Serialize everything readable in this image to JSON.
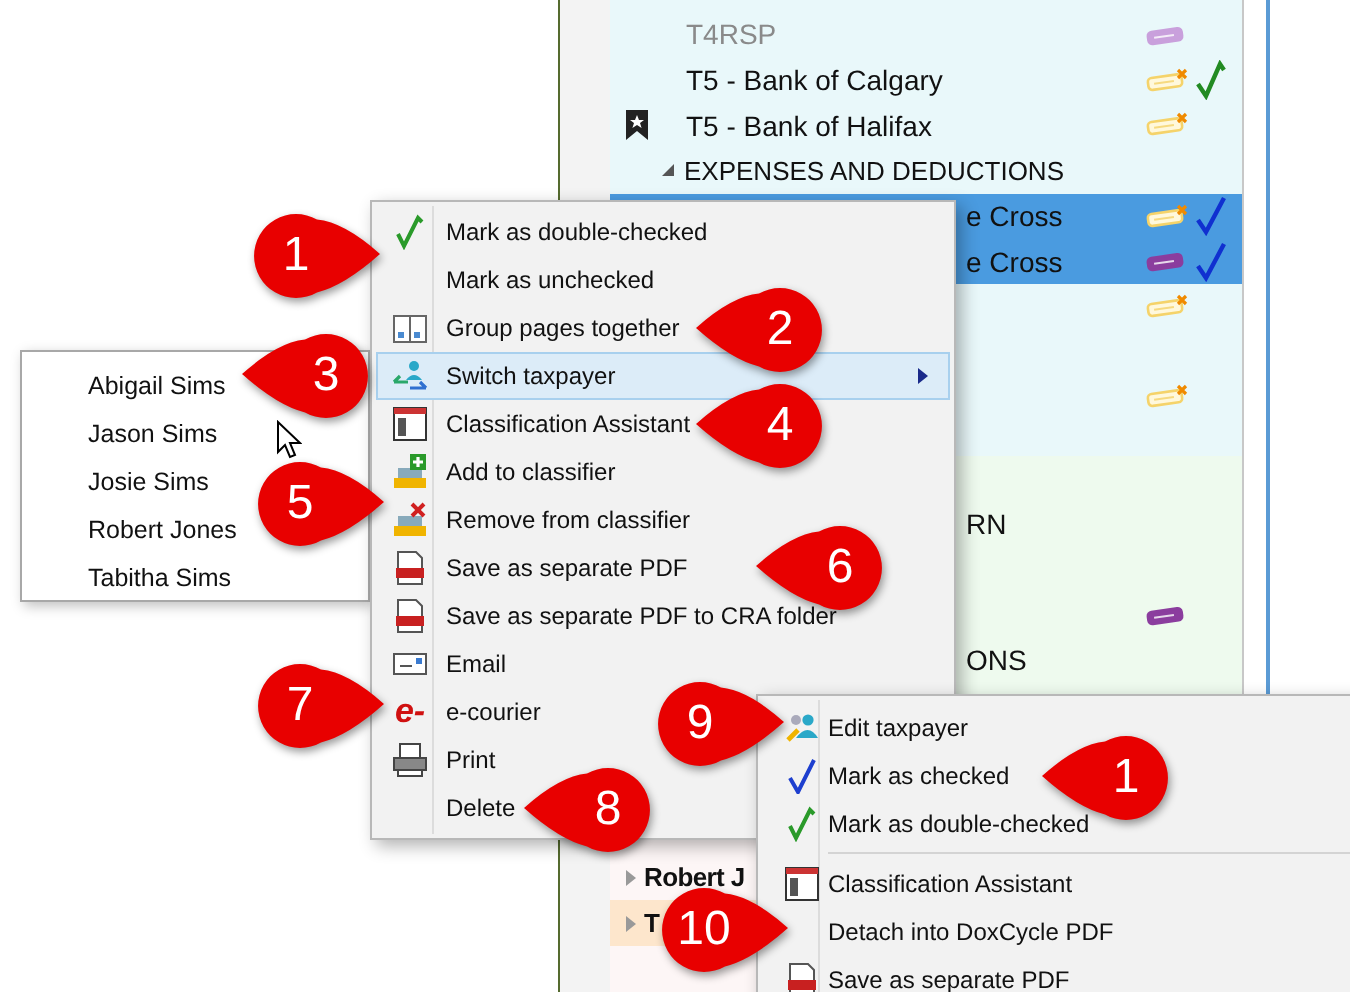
{
  "tree": {
    "groups": [
      {
        "color": "#e9f8fa",
        "rows": [
          {
            "kind": "doc",
            "label": "T4RSP",
            "dim": true,
            "bookmarked": false,
            "selected": false,
            "tag": {
              "color": "#c9a0dc",
              "flagged": false
            },
            "checked": false
          },
          {
            "kind": "doc",
            "label": "T5 - Bank of Calgary",
            "dim": false,
            "bookmarked": false,
            "selected": false,
            "tag": {
              "color": "#f5d36a",
              "flagged": true
            },
            "checked": true,
            "double": true
          },
          {
            "kind": "doc",
            "label": "T5 - Bank of Halifax",
            "dim": false,
            "bookmarked": true,
            "selected": false,
            "tag": {
              "color": "#f5d36a",
              "flagged": true
            },
            "checked": false
          },
          {
            "kind": "heading",
            "label": "EXPENSES AND DEDUCTIONS",
            "dim": false,
            "selected": false,
            "expanded": true,
            "checked": false
          },
          {
            "kind": "cut",
            "label": "e Cross",
            "dim": false,
            "selected": true,
            "tag": {
              "color": "#f5d36a",
              "flagged": true
            },
            "checked": true,
            "double": false
          },
          {
            "kind": "cut",
            "label": "e Cross",
            "dim": false,
            "selected": true,
            "tag": {
              "color": "#8b3d9e",
              "flagged": false
            },
            "checked": true,
            "double": false
          },
          {
            "kind": "blank",
            "selected": false,
            "tag": {
              "color": "#f5d36a",
              "flagged": true
            },
            "checked": false
          },
          {
            "kind": "blank",
            "selected": false,
            "checked": false
          },
          {
            "kind": "blank",
            "selected": false,
            "tag": {
              "color": "#f5d36a",
              "flagged": true
            },
            "checked": false
          }
        ]
      },
      {
        "color": "#eefaee",
        "rows": [
          {
            "kind": "blank",
            "selected": false,
            "checked": false
          },
          {
            "kind": "cut",
            "label": "RN",
            "dim": false,
            "selected": false,
            "checked": false
          },
          {
            "kind": "blank",
            "selected": false,
            "checked": false
          },
          {
            "kind": "blank",
            "selected": false,
            "tag": {
              "color": "#8b3d9e",
              "flagged": false
            },
            "checked": false
          },
          {
            "kind": "cut",
            "label": "ONS",
            "dim": false,
            "selected": false,
            "checked": false
          }
        ]
      },
      {
        "color": "#fdf6f6",
        "rows": [
          {
            "kind": "person",
            "label": "Robert J",
            "current": false,
            "expanded": false
          },
          {
            "kind": "person",
            "label": "T",
            "current": true,
            "expanded": false
          }
        ]
      }
    ]
  },
  "context_menu": {
    "items": [
      {
        "kind": "doublecheck",
        "label": "Mark as double-checked",
        "selected": false
      },
      {
        "kind": "plain",
        "label": "Mark as unchecked",
        "selected": false
      },
      {
        "kind": "pages",
        "label": "Group pages together",
        "selected": false
      },
      {
        "kind": "switch",
        "label": "Switch taxpayer",
        "selected": true,
        "submenu": true
      },
      {
        "kind": "assistant",
        "label": "Classification Assistant",
        "selected": false
      },
      {
        "kind": "add",
        "label": "Add to classifier",
        "selected": false
      },
      {
        "kind": "remove",
        "label": "Remove from classifier",
        "selected": false
      },
      {
        "kind": "pdf",
        "label": "Save as separate PDF",
        "selected": false
      },
      {
        "kind": "pdf",
        "label": "Save as separate PDF to CRA folder",
        "selected": false
      },
      {
        "kind": "email",
        "label": "Email",
        "selected": false
      },
      {
        "kind": "ecourier",
        "glyph": "e-",
        "label": "e-courier",
        "selected": false
      },
      {
        "kind": "print",
        "label": "Print",
        "selected": false
      },
      {
        "kind": "plain",
        "label": "Delete",
        "selected": false
      }
    ]
  },
  "taxpayer_submenu": {
    "items": [
      {
        "label": "Abigail Sims"
      },
      {
        "label": "Jason Sims"
      },
      {
        "label": "Josie Sims"
      },
      {
        "label": "Robert Jones"
      },
      {
        "label": "Tabitha Sims"
      }
    ]
  },
  "second_menu": {
    "items": [
      {
        "kind": "editperson",
        "label": "Edit taxpayer"
      },
      {
        "kind": "check",
        "label": "Mark as checked"
      },
      {
        "kind": "doublecheck",
        "label": "Mark as double-checked"
      },
      {
        "kind": "separator"
      },
      {
        "kind": "assistant",
        "label": "Classification Assistant"
      },
      {
        "kind": "plain",
        "label": "Detach into DoxCycle PDF"
      },
      {
        "kind": "pdf",
        "label": "Save as separate PDF"
      }
    ]
  },
  "callouts": [
    {
      "number": "1",
      "points_left": false
    },
    {
      "number": "2",
      "points_left": true
    },
    {
      "number": "3",
      "points_left": true
    },
    {
      "number": "4",
      "points_left": true
    },
    {
      "number": "5",
      "points_left": false
    },
    {
      "number": "6",
      "points_left": true
    },
    {
      "number": "7",
      "points_left": false
    },
    {
      "number": "8",
      "points_left": true
    },
    {
      "number": "9",
      "points_left": false
    },
    {
      "number": "1",
      "points_left": true
    },
    {
      "number": "10",
      "points_left": false
    }
  ]
}
